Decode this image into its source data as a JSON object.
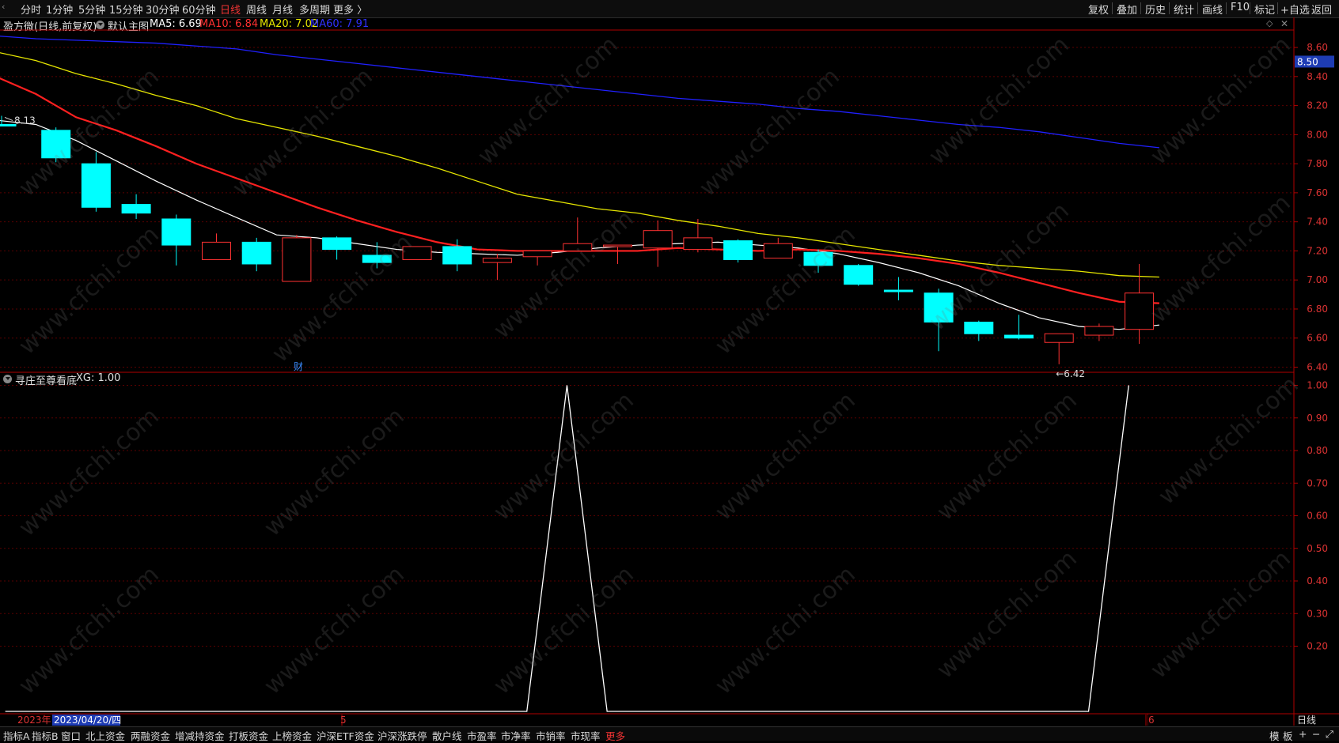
{
  "periods": [
    "分时",
    "1分钟",
    "5分钟",
    "15分钟",
    "30分钟",
    "60分钟",
    "日线",
    "周线",
    "月线",
    "多周期",
    "更多 〉"
  ],
  "active_period": "日线",
  "right_tools": [
    "复权",
    "叠加",
    "历史",
    "统计",
    "画线",
    "F10",
    "标记",
    "+自选",
    "返回"
  ],
  "main_info": {
    "title": "盈方微(日线,前复权)",
    "template": "默认主图",
    "ma5": "MA5: 6.69",
    "ma10": "MA10: 6.84",
    "ma20": "MA20: 7.02",
    "ma60": "MA60: 7.91"
  },
  "colors": {
    "up": "#ff3232",
    "down": "#00ffff",
    "ma5": "#ffffff",
    "ma10": "#ff2020",
    "ma20": "#e6e600",
    "ma60": "#2020ff",
    "axis": "#b00000",
    "grid": "#5a0000",
    "price_tag_bg": "#1e3cb4"
  },
  "sub_info": {
    "title": "寻庄至尊看底",
    "xg": "XG: 1.00"
  },
  "price_label": "8.50",
  "high_label": "8.13",
  "low_label": "←6.42",
  "finance_marker": "财",
  "date_labels": {
    "year": "2023年",
    "cursor_date": "2023/04/20/四",
    "m5": "5",
    "m6": "6"
  },
  "period_label": "日线",
  "bottom_tabs": [
    "指标A",
    "指标B",
    "窗口",
    "北上资金",
    "两融资金",
    "增减持资金",
    "打板资金",
    "上榜资金",
    "沪深ETF资金",
    "沪深涨跌停",
    "散户线",
    "市盈率",
    "市净率",
    "市销率",
    "市现率",
    "更多"
  ],
  "bottom_right": [
    "模",
    "板",
    "+",
    "−",
    "⤢"
  ],
  "watermark": "www.cfchi.com",
  "chart_data": [
    {
      "type": "candlestick",
      "title": "盈方微(日线,前复权)",
      "y_ticks": [
        6.4,
        6.6,
        6.8,
        7.0,
        7.2,
        7.4,
        7.6,
        7.8,
        8.0,
        8.2,
        8.4,
        8.6
      ],
      "ylim": [
        6.37,
        8.72
      ],
      "candles": [
        {
          "o": 8.07,
          "h": 8.13,
          "l": 8.07,
          "c": 8.06
        },
        {
          "o": 8.03,
          "h": 8.05,
          "l": 7.81,
          "c": 7.84
        },
        {
          "o": 7.8,
          "h": 7.88,
          "l": 7.47,
          "c": 7.5
        },
        {
          "o": 7.52,
          "h": 7.59,
          "l": 7.42,
          "c": 7.46
        },
        {
          "o": 7.42,
          "h": 7.45,
          "l": 7.1,
          "c": 7.24
        },
        {
          "o": 7.14,
          "h": 7.32,
          "l": 7.14,
          "c": 7.26
        },
        {
          "o": 7.26,
          "h": 7.29,
          "l": 7.06,
          "c": 7.11
        },
        {
          "o": 6.99,
          "h": 7.31,
          "l": 6.99,
          "c": 7.29
        },
        {
          "o": 7.29,
          "h": 7.3,
          "l": 7.14,
          "c": 7.21
        },
        {
          "o": 7.17,
          "h": 7.26,
          "l": 7.08,
          "c": 7.12
        },
        {
          "o": 7.14,
          "h": 7.23,
          "l": 7.14,
          "c": 7.23
        },
        {
          "o": 7.23,
          "h": 7.28,
          "l": 7.06,
          "c": 7.11
        },
        {
          "o": 7.12,
          "h": 7.18,
          "l": 7.0,
          "c": 7.15
        },
        {
          "o": 7.16,
          "h": 7.2,
          "l": 7.1,
          "c": 7.2
        },
        {
          "o": 7.2,
          "h": 7.43,
          "l": 7.2,
          "c": 7.25
        },
        {
          "o": 7.23,
          "h": 7.24,
          "l": 7.11,
          "c": 7.24
        },
        {
          "o": 7.22,
          "h": 7.41,
          "l": 7.09,
          "c": 7.34
        },
        {
          "o": 7.21,
          "h": 7.42,
          "l": 7.19,
          "c": 7.29
        },
        {
          "o": 7.27,
          "h": 7.28,
          "l": 7.12,
          "c": 7.14
        },
        {
          "o": 7.15,
          "h": 7.29,
          "l": 7.15,
          "c": 7.25
        },
        {
          "o": 7.19,
          "h": 7.21,
          "l": 7.05,
          "c": 7.1
        },
        {
          "o": 7.1,
          "h": 7.11,
          "l": 6.96,
          "c": 6.97
        },
        {
          "o": 6.93,
          "h": 7.02,
          "l": 6.86,
          "c": 6.92
        },
        {
          "o": 6.91,
          "h": 6.94,
          "l": 6.51,
          "c": 6.71
        },
        {
          "o": 6.71,
          "h": 6.72,
          "l": 6.58,
          "c": 6.63
        },
        {
          "o": 6.62,
          "h": 6.76,
          "l": 6.59,
          "c": 6.6
        },
        {
          "o": 6.57,
          "h": 6.63,
          "l": 6.42,
          "c": 6.63
        },
        {
          "o": 6.62,
          "h": 6.7,
          "l": 6.58,
          "c": 6.68
        },
        {
          "o": 6.66,
          "h": 7.11,
          "l": 6.56,
          "c": 6.91
        }
      ],
      "series": [
        {
          "name": "MA5",
          "values": [
            8.1,
            8.07,
            7.96,
            7.82,
            7.68,
            7.55,
            7.43,
            7.31,
            7.29,
            7.25,
            7.21,
            7.19,
            7.18,
            7.17,
            7.19,
            7.22,
            7.24,
            7.25,
            7.26,
            7.24,
            7.22,
            7.18,
            7.12,
            7.05,
            6.96,
            6.84,
            6.74,
            6.68,
            6.66,
            6.69
          ]
        },
        {
          "name": "MA10",
          "values": [
            8.4,
            8.28,
            8.12,
            8.03,
            7.92,
            7.8,
            7.7,
            7.6,
            7.5,
            7.41,
            7.33,
            7.26,
            7.21,
            7.2,
            7.2,
            7.2,
            7.2,
            7.22,
            7.21,
            7.2,
            7.21,
            7.2,
            7.18,
            7.15,
            7.11,
            7.05,
            6.98,
            6.91,
            6.85,
            6.84
          ]
        },
        {
          "name": "MA20",
          "values": [
            8.57,
            8.51,
            8.42,
            8.35,
            8.27,
            8.2,
            8.11,
            8.05,
            7.99,
            7.92,
            7.85,
            7.77,
            7.68,
            7.59,
            7.54,
            7.49,
            7.46,
            7.41,
            7.37,
            7.32,
            7.29,
            7.25,
            7.21,
            7.17,
            7.13,
            7.1,
            7.08,
            7.06,
            7.03,
            7.02
          ]
        },
        {
          "name": "MA60",
          "values": [
            8.68,
            8.66,
            8.65,
            8.64,
            8.63,
            8.61,
            8.59,
            8.55,
            8.52,
            8.49,
            8.46,
            8.43,
            8.4,
            8.37,
            8.34,
            8.31,
            8.28,
            8.25,
            8.23,
            8.21,
            8.18,
            8.16,
            8.13,
            8.1,
            8.07,
            8.05,
            8.02,
            7.98,
            7.94,
            7.91
          ]
        }
      ]
    },
    {
      "type": "line",
      "title": "寻庄至尊看底",
      "y_ticks": [
        0.2,
        0.3,
        0.4,
        0.5,
        0.6,
        0.7,
        0.8,
        0.9,
        1.0
      ],
      "ylim": [
        0,
        1.04
      ],
      "series": [
        {
          "name": "XG",
          "values": [
            0,
            0,
            0,
            0,
            0,
            0,
            0,
            0,
            0,
            0,
            0,
            0,
            0,
            0,
            1,
            0,
            0,
            0,
            0,
            0,
            0,
            0,
            0,
            0,
            0,
            0,
            0,
            0,
            1
          ]
        }
      ]
    }
  ]
}
